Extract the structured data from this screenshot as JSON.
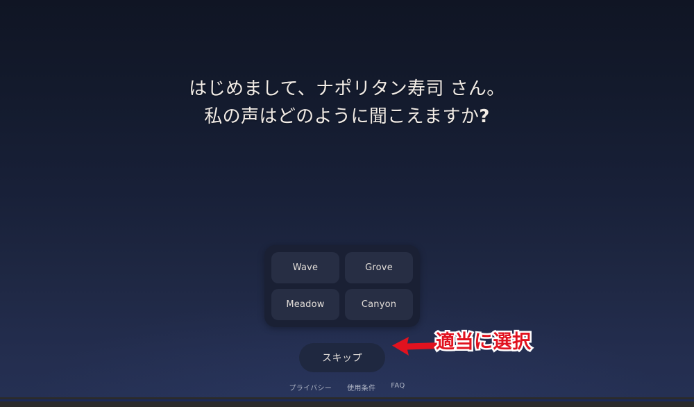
{
  "app": {
    "background_top_color": "#101524",
    "background_bottom_color": "#253053"
  },
  "greeting": {
    "line1": "はじめまして、ナポリタン寿司 さん。",
    "line2_prefix": "私の声はどのように聞こえますか",
    "line2_mark": "?"
  },
  "voice_panel": {
    "options": [
      {
        "label": "Wave",
        "name": "voice-option-wave"
      },
      {
        "label": "Grove",
        "name": "voice-option-grove"
      },
      {
        "label": "Meadow",
        "name": "voice-option-meadow"
      },
      {
        "label": "Canyon",
        "name": "voice-option-canyon"
      }
    ]
  },
  "skip": {
    "label": "スキップ"
  },
  "footer": {
    "links": [
      {
        "label": "プライバシー"
      },
      {
        "label": "使用条件"
      },
      {
        "label": "FAQ"
      }
    ]
  },
  "annotation": {
    "text": "適当に選択",
    "arrow_icon": "arrow-left-icon",
    "text_color": "#e1121f",
    "outline_color": "#ffffff",
    "arrow_color": "#e1121f"
  }
}
